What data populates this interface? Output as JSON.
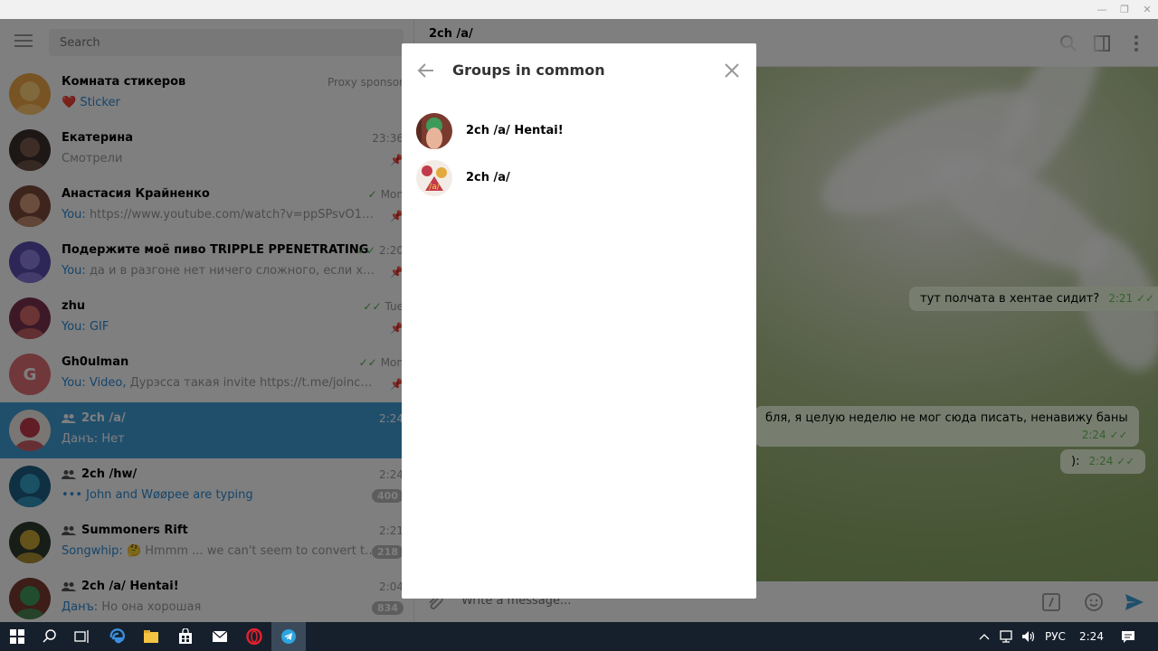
{
  "window": {
    "minimize_glyph": "—",
    "maximize_glyph": "❐",
    "close_glyph": "✕"
  },
  "search": {
    "placeholder": "Search"
  },
  "chats": [
    {
      "title": "Комната стикеров",
      "time": "Proxy sponsor",
      "sender": "",
      "preview": "❤️ Sticker",
      "preview_colored": true,
      "status": "none",
      "badge": "",
      "pinned": false,
      "group": false,
      "avatar": "sticker-room-avatar"
    },
    {
      "title": "Екатерина",
      "time": "23:36",
      "sender": "",
      "preview": "Смотрели",
      "preview_colored": false,
      "status": "none",
      "badge": "",
      "pinned": true,
      "group": false,
      "avatar": "ekaterina-avatar"
    },
    {
      "title": "Анастасия Крайненко",
      "time": "Mon",
      "sender": "You:",
      "preview": "https://www.youtube.com/watch?v=ppSPsvO19dU",
      "preview_colored": false,
      "status": "single",
      "badge": "",
      "pinned": true,
      "group": false,
      "avatar": "anastasia-avatar"
    },
    {
      "title": "Подержите моё пиво TRIPPLE PPENETRATING",
      "time": "2:20",
      "sender": "You:",
      "preview": "да и в разгоне нет ничего сложного, если хоть не...",
      "preview_colored": false,
      "status": "double",
      "badge": "",
      "pinned": true,
      "group": false,
      "avatar": "beer-avatar"
    },
    {
      "title": "zhu",
      "time": "Tue",
      "sender": "You:",
      "preview": "GIF",
      "preview_colored": true,
      "status": "double",
      "badge": "",
      "pinned": true,
      "group": false,
      "avatar": "zhu-avatar"
    },
    {
      "title": "Gh0ulman",
      "time": "Mon",
      "sender": "You: Video,",
      "preview": "Дурэсса такая  invite https://t.me/joinchat/AA...",
      "preview_colored": false,
      "status": "double",
      "badge": "",
      "pinned": true,
      "group": false,
      "avatar": "ghoulman-avatar",
      "initial": "G"
    },
    {
      "title": "2ch /a/",
      "time": "2:24",
      "sender": "Данъ:",
      "preview": "Нет",
      "preview_colored": false,
      "status": "none",
      "badge": "",
      "pinned": false,
      "group": true,
      "avatar": "2ch-a-avatar",
      "active": true
    },
    {
      "title": "2ch /hw/",
      "time": "2:24",
      "sender": "•••",
      "preview": "John and Wøøpee are typing",
      "preview_colored": true,
      "status": "none",
      "badge": "400",
      "pinned": false,
      "group": true,
      "avatar": "2ch-hw-avatar"
    },
    {
      "title": "Summoners Rift",
      "time": "2:21",
      "sender": "Songwhip:",
      "preview": "🤔 Hmmm ... we can't seem to convert that l...",
      "preview_colored": false,
      "status": "none",
      "badge": "218",
      "pinned": false,
      "group": true,
      "avatar": "summoners-avatar"
    },
    {
      "title": "2ch /a/ Hentai!",
      "time": "2:04",
      "sender": "Данъ:",
      "preview": "Но она хорошая",
      "preview_colored": false,
      "status": "none",
      "badge": "834",
      "pinned": false,
      "group": true,
      "avatar": "2ch-a-hentai-avatar"
    }
  ],
  "conversation": {
    "title": "2ch /a/",
    "messages": [
      {
        "text": "тут полчата в хентае сидит?",
        "time": "2:21"
      },
      {
        "text": "бля, я целую неделю не мог сюда писать, ненавижу баны",
        "time": "2:24"
      },
      {
        "text": "):",
        "time": "2:24"
      }
    ],
    "composer_placeholder": "Write a message..."
  },
  "modal": {
    "title": "Groups in common",
    "groups": [
      {
        "name": "2ch /a/ Hentai!"
      },
      {
        "name": "2ch /a/"
      }
    ]
  },
  "taskbar": {
    "language": "РУС",
    "clock": "2:24"
  },
  "colors": {
    "accent": "#419fd9",
    "link": "#2a8ad6",
    "check": "#4fae4e",
    "message_bg": "#effdde",
    "taskbar": "#16202c"
  }
}
